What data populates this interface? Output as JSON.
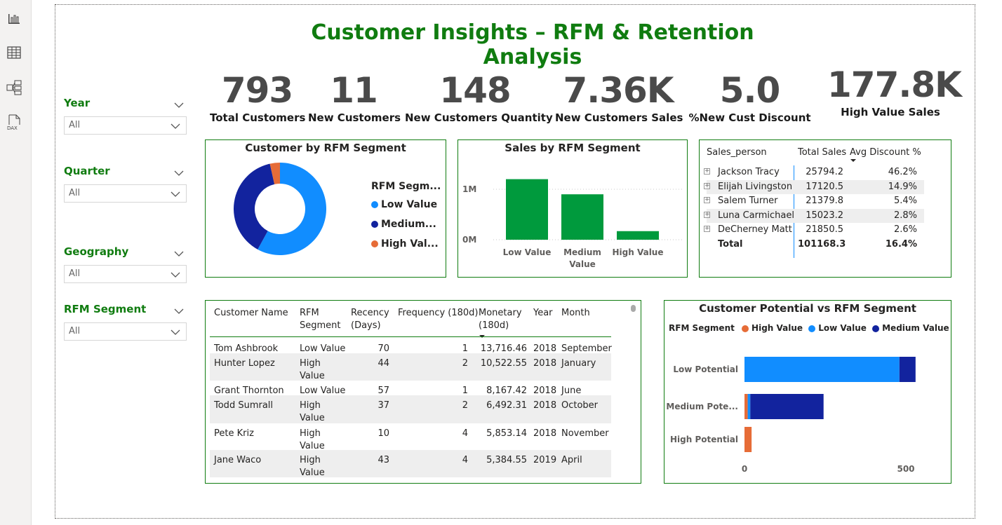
{
  "left_nav": [
    {
      "icon": "report-view-icon"
    },
    {
      "icon": "table-view-icon"
    },
    {
      "icon": "model-view-icon"
    },
    {
      "icon": "dax-query-view-icon",
      "label": "DAX"
    }
  ],
  "title": "Customer Insights – RFM & Retention Analysis",
  "kpis": [
    {
      "value": "793",
      "label": "Total Customers"
    },
    {
      "value": "11",
      "label": "New Customers"
    },
    {
      "value": "148",
      "label": "New Customers Quantity"
    },
    {
      "value": "7.36K",
      "label": "New Customers Sales"
    },
    {
      "value": "5.0",
      "label": "%New Cust Discount"
    },
    {
      "value": "177.8K",
      "label": "High Value Sales"
    }
  ],
  "slicers": [
    {
      "label": "Year",
      "value": "All"
    },
    {
      "label": "Quarter",
      "value": "All"
    },
    {
      "label": "Geography",
      "value": "All"
    },
    {
      "label": "RFM Segment",
      "value": "All"
    }
  ],
  "colors": {
    "accent": "#107c10",
    "low_value": "#118dff",
    "medium_value": "#12239e",
    "high_value": "#e66c37",
    "bar_green": "#009a3d"
  },
  "donut": {
    "title": "Customer by RFM Segment",
    "legend_title": "RFM Segm...",
    "legend": [
      "Low Value",
      "Medium...",
      "High Val..."
    ]
  },
  "sales_bar": {
    "title": "Sales by RFM Segment",
    "yticks": [
      "1M",
      "0M"
    ],
    "categories": [
      "Low Value",
      "Medium Value",
      "High Value"
    ]
  },
  "salesperson_table": {
    "headers": [
      "Sales_person",
      "Total Sales",
      "Avg Discount %"
    ],
    "rows": [
      [
        "Jackson Tracy",
        "25794.2",
        "46.2%"
      ],
      [
        "Elijah Livingston",
        "17120.5",
        "14.9%"
      ],
      [
        "Salem Turner",
        "21379.8",
        "5.4%"
      ],
      [
        "Luna Carmichael",
        "15023.2",
        "2.8%"
      ],
      [
        "DeCherney Matt",
        "21850.5",
        "2.6%"
      ]
    ],
    "total": [
      "Total",
      "101168.3",
      "16.4%"
    ]
  },
  "customer_table": {
    "headers": [
      "Customer Name",
      "RFM Segment",
      "Recency (Days)",
      "Frequency (180d)",
      "Monetary (180d)",
      "Year",
      "Month"
    ],
    "rows": [
      [
        "Tom Ashbrook",
        "Low Value",
        "70",
        "1",
        "13,716.46",
        "2018",
        "September"
      ],
      [
        "Hunter Lopez",
        "High Value",
        "44",
        "2",
        "10,522.55",
        "2018",
        "January"
      ],
      [
        "Grant Thornton",
        "Low Value",
        "57",
        "1",
        "8,167.42",
        "2018",
        "June"
      ],
      [
        "Todd Sumrall",
        "High Value",
        "37",
        "2",
        "6,492.31",
        "2018",
        "October"
      ],
      [
        "Pete Kriz",
        "High Value",
        "10",
        "4",
        "5,853.14",
        "2018",
        "November"
      ],
      [
        "Jane Waco",
        "High Value",
        "43",
        "4",
        "5,384.55",
        "2019",
        "April"
      ]
    ]
  },
  "potential_chart": {
    "title": "Customer Potential vs RFM Segment",
    "legend_title": "RFM Segment",
    "legend": [
      "High Value",
      "Low Value",
      "Medium Value"
    ],
    "categories": [
      "Low Potential",
      "Medium Pote...",
      "High Potential"
    ],
    "xticks": [
      "0",
      "500"
    ]
  },
  "chart_data": [
    {
      "type": "pie",
      "title": "Customer by RFM Segment",
      "legend_title": "RFM Segm...",
      "categories": [
        "Low Value",
        "Medium...",
        "High Val..."
      ],
      "values": [
        58,
        38.5,
        3.5
      ]
    },
    {
      "type": "bar",
      "title": "Sales by RFM Segment",
      "categories": [
        "Low Value",
        "Medium Value",
        "High Value"
      ],
      "values": [
        1200000,
        900000,
        170000
      ],
      "ylim": [
        0,
        1300000
      ],
      "yticks": [
        "1M",
        "0M"
      ]
    },
    {
      "type": "bar",
      "orientation": "horizontal",
      "stacked": true,
      "title": "Customer Potential vs RFM Segment",
      "legend_title": "RFM Segment",
      "categories": [
        "Low Potential",
        "Medium Pote...",
        "High Potential"
      ],
      "series": [
        {
          "name": "High Value",
          "values": [
            0,
            10,
            22
          ]
        },
        {
          "name": "Low Value",
          "values": [
            480,
            8,
            0
          ]
        },
        {
          "name": "Medium Value",
          "values": [
            50,
            227,
            0
          ]
        }
      ],
      "xlim": [
        0,
        540
      ],
      "xticks": [
        0,
        500
      ]
    }
  ]
}
